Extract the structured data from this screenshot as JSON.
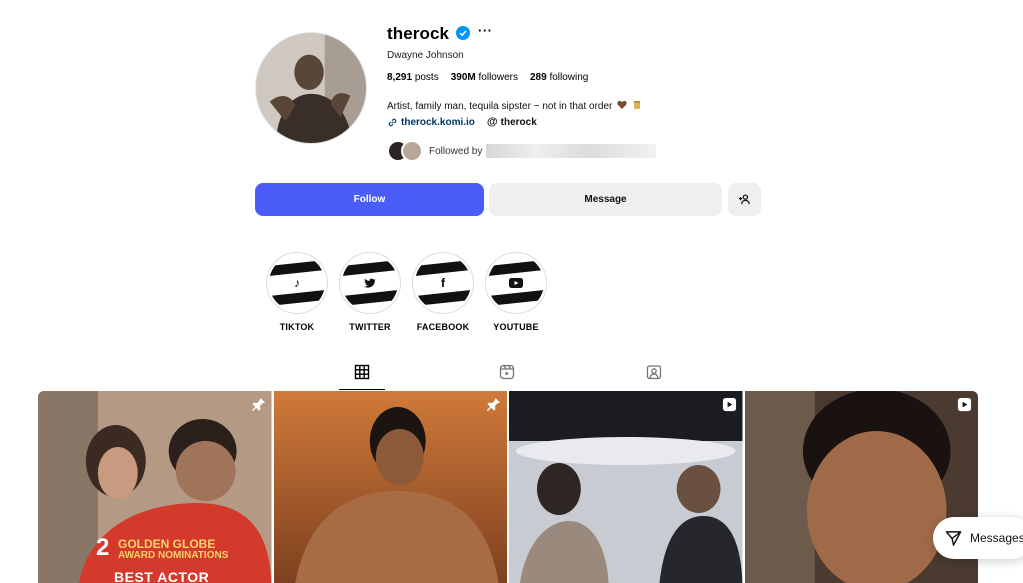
{
  "profile": {
    "username": "therock",
    "full_name": "Dwayne Johnson",
    "more_icon": "more-dots-icon",
    "verified_color": "#0095f6"
  },
  "stats": {
    "posts_count": "8,291",
    "posts_label": "posts",
    "followers_count": "390M",
    "followers_label": "followers",
    "following_count": "289",
    "following_label": "following"
  },
  "bio": {
    "text": "Artist, family man, tequila sipster ~ not in that order",
    "link": "therock.komi.io",
    "threads_handle": "therock",
    "followed_by": "Followed by"
  },
  "actions": {
    "follow": "Follow",
    "message": "Message",
    "follow_color": "#4a5df9"
  },
  "highlights": [
    {
      "label": "TIKTOK",
      "icon": "♪"
    },
    {
      "label": "TWITTER",
      "icon": "🐦"
    },
    {
      "label": "FACEBOOK",
      "icon": "f"
    },
    {
      "label": "YOUTUBE",
      "icon": "▶"
    }
  ],
  "tabs": [
    {
      "name": "posts-grid-icon"
    },
    {
      "name": "reels-icon"
    },
    {
      "name": "tagged-icon"
    }
  ],
  "posts": [
    {
      "badge": "pin-icon",
      "overlay": {
        "number": "2",
        "line1": "GOLDEN GLOBE",
        "line2": "AWARD NOMINATIONS",
        "line3": "BEST ACTOR"
      }
    },
    {
      "badge": "pin-icon"
    },
    {
      "badge": "reel-icon"
    },
    {
      "badge": "reel-icon"
    }
  ],
  "messages_label": "Messages"
}
